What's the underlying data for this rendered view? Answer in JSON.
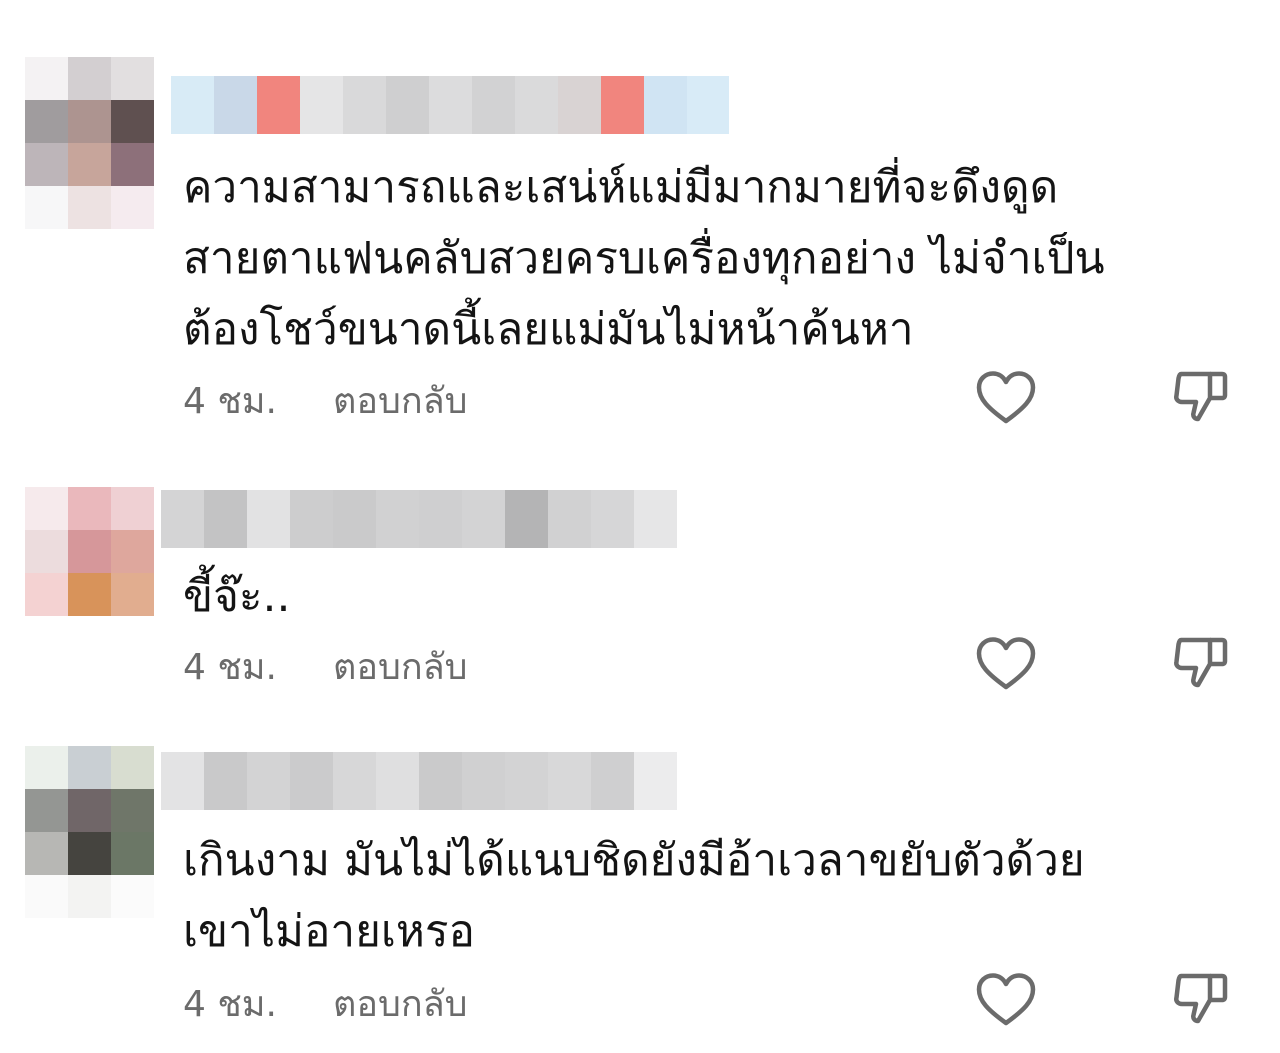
{
  "comments": [
    {
      "text": "ความสามารถและเสน่ห์แม่มีมากมายที่จะดึงดูด\nสายตาแฟนคลับสวยครบเครื่องทุกอย่าง ไม่จำเป็น\nต้องโชว์ขนาดนี้เลยแม่มันไม่หน้าค้นหา",
      "time": "4 ชม.",
      "reply_label": "ตอบกลับ",
      "avatar_icon": "avatar-blurred",
      "like_icon": "heart-outline-icon",
      "dislike_icon": "thumbs-down-outline-icon"
    },
    {
      "text": "ขี้จ๊ะ..",
      "time": "4 ชม.",
      "reply_label": "ตอบกลับ",
      "avatar_icon": "avatar-blurred",
      "like_icon": "heart-outline-icon",
      "dislike_icon": "thumbs-down-outline-icon"
    },
    {
      "text": "เกินงาม มันไม่ได้แนบชิดยังมีอ้าเวลาขยับตัวด้วย\nเขาไม่อายเหรอ",
      "time": "4 ชม.",
      "reply_label": "ตอบกลับ",
      "avatar_icon": "avatar-blurred",
      "like_icon": "heart-outline-icon",
      "dislike_icon": "thumbs-down-outline-icon"
    }
  ],
  "colors": {
    "text": "#141414",
    "meta": "#6b6b6b",
    "icon": "#6b6b6b",
    "background": "#ffffff"
  }
}
